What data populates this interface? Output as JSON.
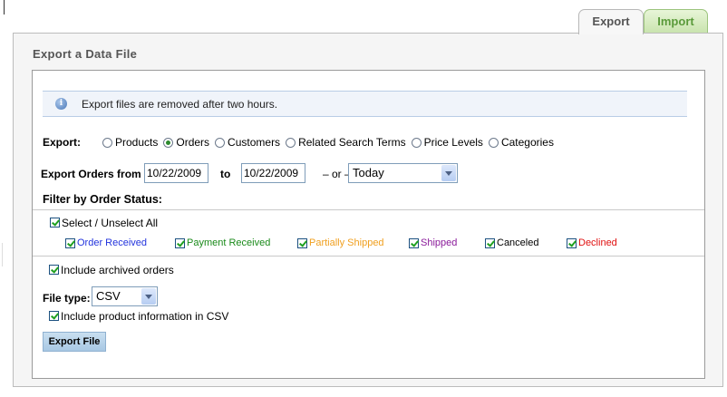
{
  "tabs": [
    {
      "label": "Export",
      "active": true
    },
    {
      "label": "Import",
      "active": false
    }
  ],
  "panel": {
    "title": "Export a Data File"
  },
  "info": {
    "icon": "info-icon",
    "text": "Export files are removed after two hours."
  },
  "export_type": {
    "label": "Export:",
    "options": [
      "Products",
      "Orders",
      "Customers",
      "Related Search Terms",
      "Price Levels",
      "Categories"
    ],
    "selected": "Orders"
  },
  "date_range": {
    "label": "Export Orders from",
    "from": "10/22/2009",
    "to_label": "to",
    "to": "10/22/2009",
    "or_label": "– or –",
    "preset": "Today"
  },
  "filter": {
    "heading": "Filter by Order Status:",
    "select_all_label": "Select / Unselect All",
    "statuses": [
      {
        "label": "Order Received",
        "color": "#2233dd",
        "checked": true
      },
      {
        "label": "Payment Received",
        "color": "#1a8a1a",
        "checked": true
      },
      {
        "label": "Partially Shipped",
        "color": "#f0a020",
        "checked": true
      },
      {
        "label": "Shipped",
        "color": "#8a1a9a",
        "checked": true
      },
      {
        "label": "Canceled",
        "color": "#000000",
        "checked": true
      },
      {
        "label": "Declined",
        "color": "#e01010",
        "checked": true
      }
    ]
  },
  "archived_label": "Include archived orders",
  "file_type": {
    "label": "File type:",
    "value": "CSV"
  },
  "include_product_label": "Include product information in CSV",
  "export_button": "Export File"
}
